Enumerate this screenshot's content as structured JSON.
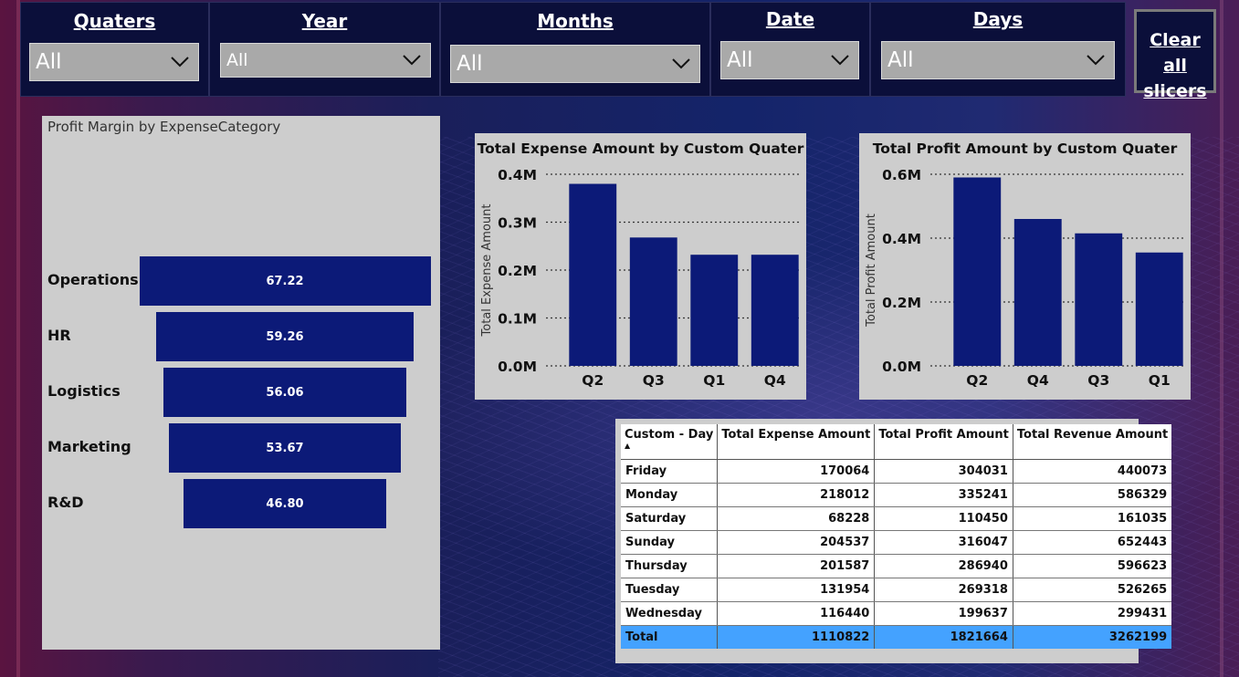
{
  "slicers": [
    {
      "title": "Quaters",
      "value": "All"
    },
    {
      "title": "Year",
      "value": "All"
    },
    {
      "title": "Months",
      "value": "All"
    },
    {
      "title": "Date",
      "value": "All"
    },
    {
      "title": "Days",
      "value": "All"
    }
  ],
  "clear_button": {
    "line1": "Clear all",
    "line2": "slicers"
  },
  "funnel": {
    "title": "Profit Margin by ExpenseCategory",
    "categories": [
      "Operations",
      "HR",
      "Logistics",
      "Marketing",
      "R&D"
    ],
    "values": [
      67.22,
      59.26,
      56.06,
      53.67,
      46.8
    ],
    "value_labels": [
      "67.22",
      "59.26",
      "56.06",
      "53.67",
      "46.80"
    ]
  },
  "chart_data": [
    {
      "type": "bar",
      "title": "Total Expense Amount by Custom Quater",
      "xlabel": "",
      "ylabel": "Total Expense Amount",
      "categories": [
        "Q2",
        "Q3",
        "Q1",
        "Q4"
      ],
      "values": [
        380000,
        268000,
        232000,
        232000
      ],
      "ylim": [
        0,
        400000
      ],
      "yticks": [
        0,
        100000,
        200000,
        300000,
        400000
      ],
      "ytick_labels": [
        "0.0M",
        "0.1M",
        "0.2M",
        "0.3M",
        "0.4M"
      ],
      "grid": true,
      "color": "#0c1a78"
    },
    {
      "type": "bar",
      "title": "Total Profit Amount by Custom Quater",
      "xlabel": "",
      "ylabel": "Total Profit Amount",
      "categories": [
        "Q2",
        "Q4",
        "Q3",
        "Q1"
      ],
      "values": [
        590000,
        460000,
        415000,
        355000
      ],
      "ylim": [
        0,
        600000
      ],
      "yticks": [
        0,
        200000,
        400000,
        600000
      ],
      "ytick_labels": [
        "0.0M",
        "0.2M",
        "0.4M",
        "0.6M"
      ],
      "grid": true,
      "color": "#0c1a78"
    }
  ],
  "table": {
    "headers": [
      "Custom - Day",
      "Total Expense Amount",
      "Total Profit Amount",
      "Total Revenue Amount"
    ],
    "rows": [
      [
        "Friday",
        "170064",
        "304031",
        "440073"
      ],
      [
        "Monday",
        "218012",
        "335241",
        "586329"
      ],
      [
        "Saturday",
        "68228",
        "110450",
        "161035"
      ],
      [
        "Sunday",
        "204537",
        "316047",
        "652443"
      ],
      [
        "Thursday",
        "201587",
        "286940",
        "596623"
      ],
      [
        "Tuesday",
        "131954",
        "269318",
        "526265"
      ],
      [
        "Wednesday",
        "116440",
        "199637",
        "299431"
      ]
    ],
    "total": [
      "Total",
      "1110822",
      "1821664",
      "3262199"
    ],
    "total_color": "#44a2ff"
  }
}
